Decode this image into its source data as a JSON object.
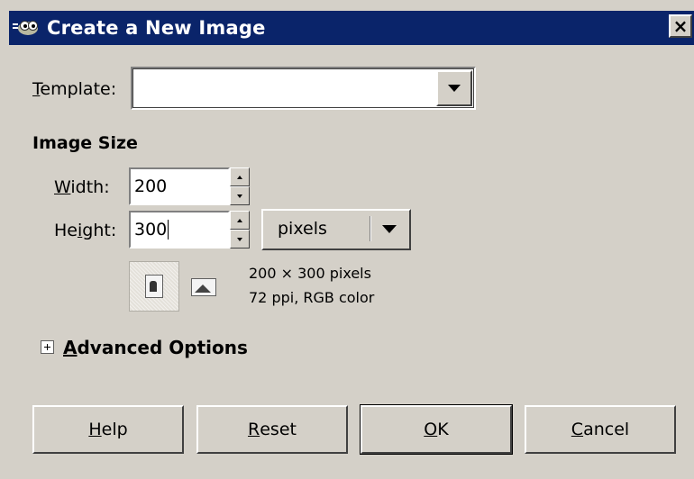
{
  "window": {
    "title": "Create a New Image",
    "close_glyph": "×"
  },
  "template": {
    "label_mnemonic": "T",
    "label_rest": "emplate:",
    "value": ""
  },
  "image_size": {
    "heading": "Image Size",
    "width": {
      "label_mnemonic": "W",
      "label_rest": "idth:",
      "value": "200"
    },
    "height": {
      "label_pre": "He",
      "label_mnemonic": "i",
      "label_rest": "ght:",
      "value": "300"
    },
    "unit": "pixels",
    "info_dimensions": "200 × 300 pixels",
    "info_resolution": "72 ppi, RGB color"
  },
  "advanced": {
    "label_mnemonic": "A",
    "label_rest": "dvanced Options"
  },
  "buttons": {
    "help": {
      "mnemonic": "H",
      "rest": "elp"
    },
    "reset": {
      "mnemonic": "R",
      "rest": "eset"
    },
    "ok": {
      "mnemonic": "O",
      "rest": "K"
    },
    "cancel": {
      "mnemonic": "C",
      "rest": "ancel"
    }
  },
  "colors": {
    "titlebar": "#0a246a",
    "face": "#d4d0c8"
  }
}
